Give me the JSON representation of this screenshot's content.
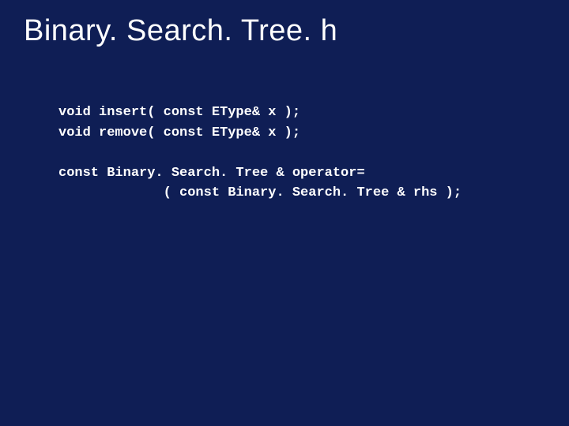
{
  "title": "Binary. Search. Tree. h",
  "code": {
    "line1": "void insert( const EType& x );",
    "line2": "void remove( const EType& x );",
    "blank1": "",
    "line3": "const Binary. Search. Tree & operator=",
    "line4": "             ( const Binary. Search. Tree & rhs );"
  }
}
